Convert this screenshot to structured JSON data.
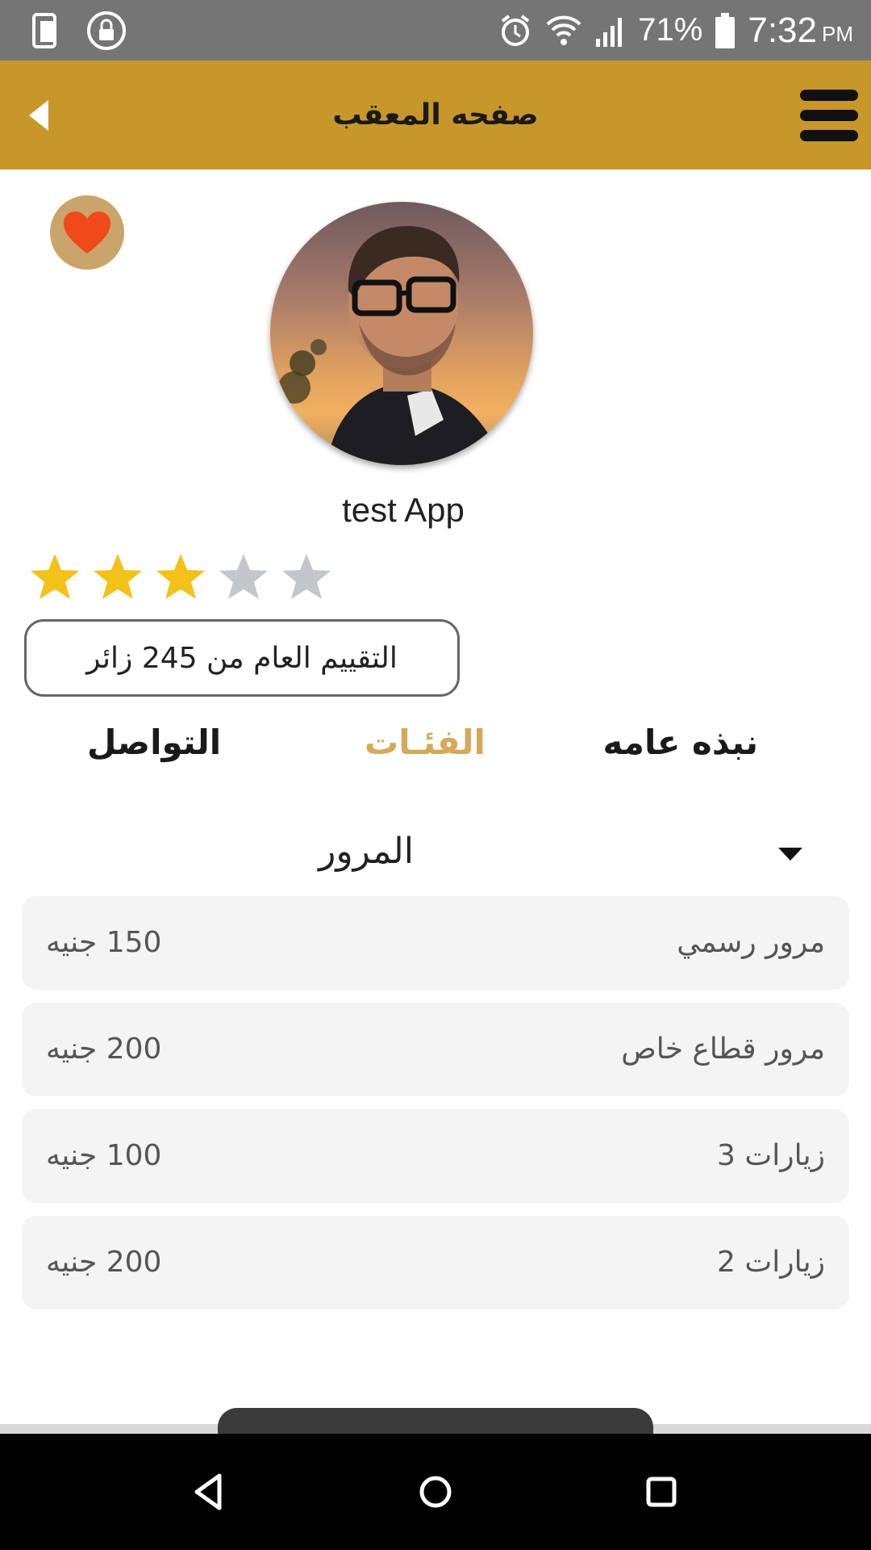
{
  "status_bar": {
    "battery": "71%",
    "time": "7:32",
    "ampm": "PM",
    "icons": [
      "phone-icon",
      "lock-icon",
      "alarm-icon",
      "wifi-icon",
      "signal-icon",
      "battery-icon"
    ]
  },
  "app_bar": {
    "title": "صفحه المعقب",
    "color": "#c8972a"
  },
  "profile": {
    "name": "test App",
    "rating": 3,
    "max_rating": 5,
    "rating_summary": "التقييم العام من 245 زائر"
  },
  "tabs": [
    {
      "label": "نبذه عامه",
      "active": false
    },
    {
      "label": "الفئـات",
      "active": true
    },
    {
      "label": "التواصل",
      "active": false
    }
  ],
  "section": {
    "title": "المرور"
  },
  "items": [
    {
      "label": "مرور رسمي",
      "price": "150 جنيه"
    },
    {
      "label": "مرور قطاع خاص",
      "price": "200 جنيه"
    },
    {
      "label": "زيارات 3",
      "price": "100 جنيه"
    },
    {
      "label": "زيارات 2",
      "price": "200 جنيه"
    }
  ],
  "colors": {
    "accent": "#c8972a",
    "active_tab": "#d4a95a",
    "star_filled": "#f2c21b",
    "star_empty": "#c3c7cc",
    "heart": "#f04a1a"
  }
}
